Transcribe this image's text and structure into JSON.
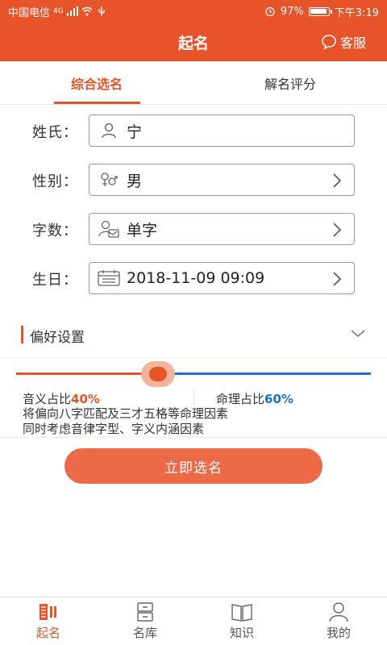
{
  "status": {
    "carrier": "中国电信",
    "network": "4G",
    "battery": "97%",
    "battery_level": 0.97,
    "time": "下午3:19"
  },
  "header": {
    "title": "起名",
    "service_label": "客服"
  },
  "tabs": [
    {
      "label": "综合选名",
      "active": true
    },
    {
      "label": "解名评分",
      "active": false
    }
  ],
  "form": {
    "surname": {
      "label": "姓氏：",
      "value": "宁"
    },
    "gender": {
      "label": "性别：",
      "value": "男"
    },
    "count": {
      "label": "字数：",
      "value": "单字"
    },
    "birthday": {
      "label": "生日：",
      "value": "2018-11-09 09:09"
    }
  },
  "preference": {
    "label": "偏好设置"
  },
  "slider": {
    "sound_label": "音义占比",
    "sound_pct": "40%",
    "fate_label": "命理占比",
    "fate_pct": "60%",
    "value": 0.4
  },
  "description": {
    "line1": "将偏向八字匹配及三才五格等命理因素",
    "line2": "同时考虑音律字型、字义内涵因素"
  },
  "cta": {
    "label": "立即选名"
  },
  "tabbar": [
    {
      "label": "起名",
      "icon": "naming-icon",
      "active": true
    },
    {
      "label": "名库",
      "icon": "name-library-icon",
      "active": false
    },
    {
      "label": "知识",
      "icon": "book-icon",
      "active": false
    },
    {
      "label": "我的",
      "icon": "user-icon",
      "active": false
    }
  ],
  "colors": {
    "brand": "#e8542a",
    "blue": "#1a73c4",
    "cta": "#ec6a48"
  }
}
